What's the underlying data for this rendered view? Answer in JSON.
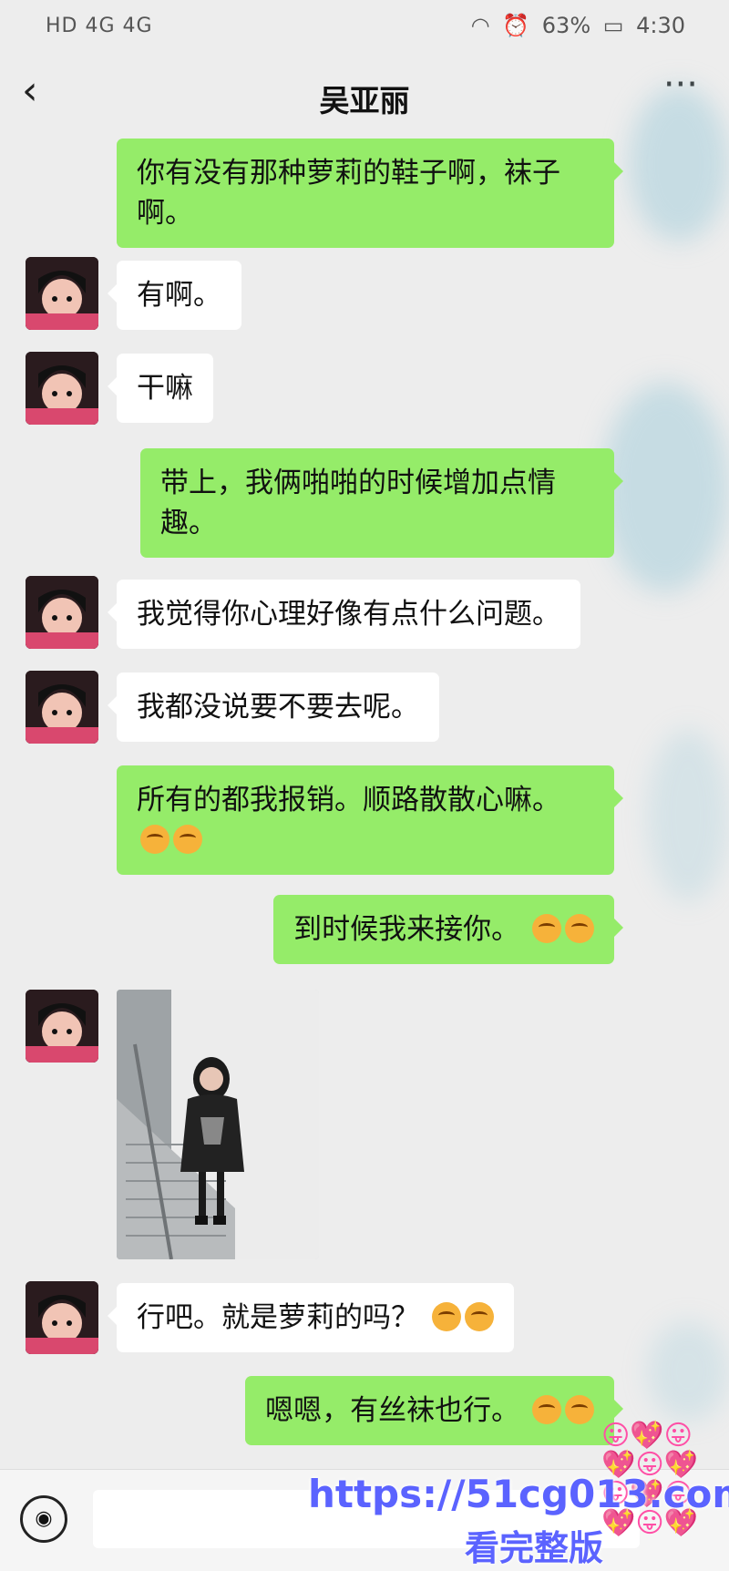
{
  "status": {
    "left_icons": "HD 4G 4G",
    "battery": "63%",
    "time": "4:30"
  },
  "header": {
    "back_icon": "‹",
    "title": "吴亚丽",
    "more_icon": "···"
  },
  "messages": [
    {
      "side": "out",
      "text": "你有没有那种萝莉的鞋子啊，袜子啊。"
    },
    {
      "side": "in",
      "text": "有啊。"
    },
    {
      "side": "in",
      "text": "干嘛"
    },
    {
      "side": "out",
      "text": "带上，我俩啪啪的时候增加点情趣。"
    },
    {
      "side": "in",
      "text": "我觉得你心理好像有点什么问题。"
    },
    {
      "side": "in",
      "text": "我都没说要不要去呢。"
    },
    {
      "side": "out",
      "text": "所有的都我报销。顺路散散心嘛。"
    },
    {
      "side": "out",
      "text": "到时候我来接你。"
    },
    {
      "side": "in",
      "text": "photo"
    },
    {
      "side": "in",
      "text": "行吧。就是萝莉的吗？"
    },
    {
      "side": "out",
      "text": "嗯嗯，有丝袜也行。"
    }
  ],
  "input": {
    "voice_icon": "voice-icon",
    "placeholder": ""
  },
  "watermark": {
    "url": "https://51cg013.com",
    "cta": "看完整版"
  },
  "colors": {
    "background": "#ededed",
    "bubble_out": "#95ec69",
    "bubble_in": "#ffffff",
    "watermark": "#5b63ff"
  }
}
